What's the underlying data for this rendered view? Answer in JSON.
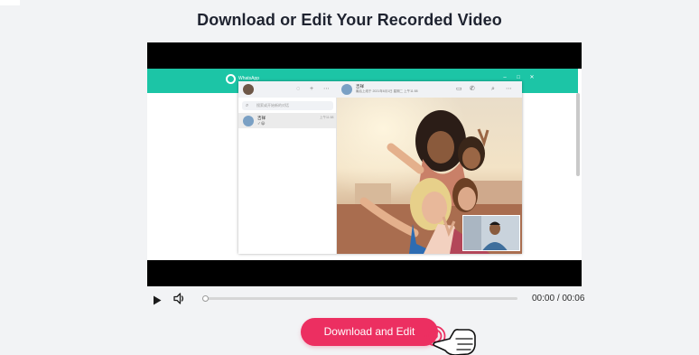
{
  "page": {
    "title": "Download or Edit Your Recorded Video"
  },
  "video": {
    "whatsapp_window": {
      "title": "WhatsApp",
      "search_placeholder": "搜索或开始新的对话",
      "chat_item": {
        "name": "吉祥",
        "time": "上午11:58",
        "preview": "✓😀"
      },
      "chat_header": {
        "name": "吉祥",
        "status": "最后上线于 2021年6月1日 星期二 上午11:58"
      }
    },
    "colors": {
      "whatsapp_bar": "#1cc5a6",
      "frame": "#000000"
    }
  },
  "player": {
    "current_time": "00:00",
    "separator": "/",
    "duration": "00:06",
    "progress": 0
  },
  "actions": {
    "download_label": "Download and Edit",
    "accent_color": "#ec2f61"
  },
  "icons": {
    "play": "play-icon",
    "volume": "volume-icon",
    "cursor": "hand-pointer-icon"
  }
}
